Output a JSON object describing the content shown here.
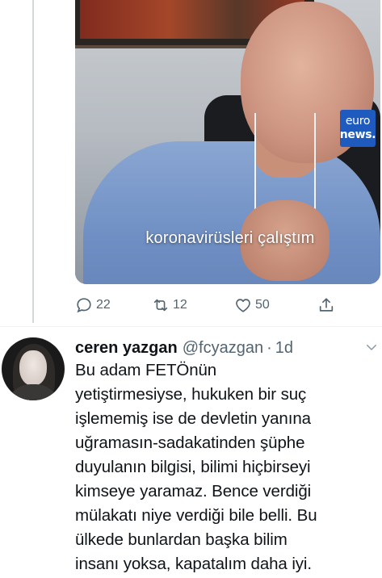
{
  "video": {
    "caption": "koronavirüsleri çalıştım",
    "logo_line1": "euro",
    "logo_line2": "news."
  },
  "actions": {
    "reply_count": "22",
    "retweet_count": "12",
    "like_count": "50"
  },
  "tweet": {
    "name": "ceren yazgan",
    "handle": "@fcyazgan",
    "separator": "·",
    "time": "1d",
    "text": "Bu adam FETÖnün\nyetiştirmesiyse,  hukuken bir suç\nişlememiş ise de devletin yanına\nuğramasın-sadakatinden şüphe\nduyulanın bilgisi, bilimi hiçbirseyi\nkimseye yaramaz. Bence verdiği\nmülakatı niye verdiği bile belli.  Bu\nülkede bunlardan başka bilim\ninsanı yoksa, kapatalım daha iyi."
  },
  "icons": [
    "reply-icon",
    "retweet-icon",
    "like-icon",
    "share-icon",
    "chevron-down-icon"
  ],
  "colors": {
    "muted": "#536471",
    "text": "#0f1419",
    "logo_bg": "#1f5bbf"
  }
}
